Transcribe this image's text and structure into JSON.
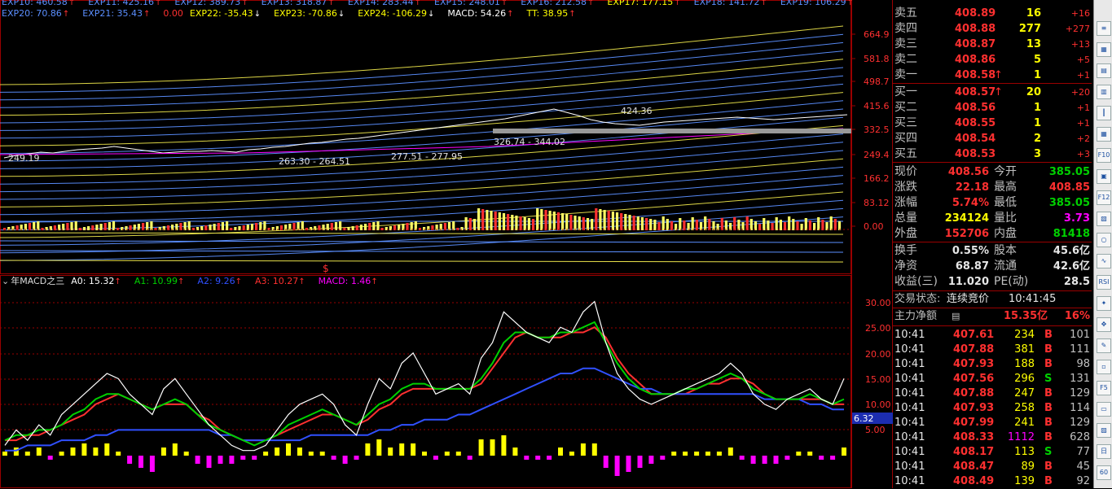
{
  "main_chart": {
    "legend_row1": [
      {
        "label": "EXP10: 460.58",
        "dir": "up"
      },
      {
        "label": "EXP11: 425.16",
        "dir": "up"
      },
      {
        "label": "EXP12: 389.73",
        "dir": "up"
      },
      {
        "label": "EXP13: 318.87",
        "dir": "up"
      },
      {
        "label": "EXP14: 283.44",
        "dir": "up"
      },
      {
        "label": "EXP15: 248.01",
        "dir": "up"
      },
      {
        "label": "EXP16: 212.58",
        "dir": "up"
      },
      {
        "label": "EXP17: 177.15",
        "dir": "up"
      },
      {
        "label": "EXP18: 141.72",
        "dir": "up"
      },
      {
        "label": "EXP19: 106.29",
        "dir": "up"
      }
    ],
    "legend_row2": [
      {
        "label": "EXP20: 70.86",
        "dir": "up"
      },
      {
        "label": "EXP21: 35.43",
        "dir": "up"
      },
      {
        "label": "0.00",
        "dir": "none"
      },
      {
        "label": "EXP22: -35.43",
        "dir": "down"
      },
      {
        "label": "EXP23: -70.86",
        "dir": "down"
      },
      {
        "label": "EXP24: -106.29",
        "dir": "down"
      },
      {
        "label": "MACD: 54.26",
        "dir": "up"
      },
      {
        "label": "TT: 38.95",
        "dir": "up"
      }
    ],
    "y_axis_labels": [
      "664.9",
      "581.8",
      "498.7",
      "415.6",
      "332.5",
      "249.4",
      "166.2",
      "83.12",
      "0.00"
    ],
    "annotations": [
      "249.19",
      "263.30 - 264.51",
      "277.51 - 277.95",
      "326.74 - 344.02",
      "424.36"
    ],
    "marker": "$"
  },
  "macd_panel": {
    "name": "年MACD之三",
    "legend": [
      {
        "label": "A0: 15.32",
        "color": "#ffffff"
      },
      {
        "label": "A1: 10.99",
        "color": "#00d000"
      },
      {
        "label": "A2: 9.26",
        "color": "#3050ff"
      },
      {
        "label": "A3: 10.27",
        "color": "#ff3030"
      },
      {
        "label": "MACD: 1.46",
        "color": "#ff00ff"
      }
    ],
    "y_axis_labels": [
      "30.00",
      "25.00",
      "20.00",
      "15.00",
      "10.00",
      "5.00"
    ],
    "current_value": "6.32"
  },
  "chart_data": {
    "type": "line",
    "title": "年MACD之三",
    "ylim": [
      0,
      32
    ],
    "series": [
      {
        "name": "A0",
        "values": [
          2,
          5,
          3,
          6,
          4,
          8,
          10,
          12,
          14,
          16,
          15,
          12,
          10,
          8,
          13,
          15,
          12,
          9,
          6,
          4,
          2,
          1,
          1,
          2,
          5,
          8,
          10,
          11,
          12,
          10,
          6,
          4,
          10,
          15,
          13,
          18,
          20,
          16,
          12,
          13,
          14,
          12,
          19,
          22,
          28,
          26,
          24,
          23,
          22,
          25,
          24,
          28,
          30,
          22,
          16,
          13,
          11,
          10,
          11,
          12,
          13,
          14,
          15,
          16,
          18,
          16,
          12,
          10,
          9,
          11,
          12,
          13,
          11,
          10,
          15
        ],
        "color": "#ffffff"
      },
      {
        "name": "A1",
        "values": [
          3,
          4,
          4,
          5,
          5,
          6,
          8,
          9,
          11,
          12,
          12,
          11,
          10,
          9,
          10,
          11,
          10,
          8,
          6,
          5,
          4,
          3,
          2,
          3,
          4,
          6,
          7,
          8,
          9,
          8,
          7,
          6,
          8,
          10,
          11,
          13,
          14,
          14,
          13,
          13,
          13,
          13,
          15,
          18,
          22,
          24,
          24,
          23,
          23,
          24,
          24,
          25,
          26,
          22,
          18,
          15,
          13,
          12,
          12,
          12,
          13,
          13,
          14,
          15,
          16,
          15,
          13,
          12,
          11,
          11,
          11,
          12,
          11,
          10,
          11
        ],
        "color": "#00d000"
      },
      {
        "name": "A2",
        "values": [
          1,
          1,
          2,
          2,
          2,
          3,
          3,
          3,
          4,
          4,
          5,
          5,
          5,
          5,
          5,
          5,
          5,
          5,
          5,
          4,
          4,
          3,
          3,
          3,
          3,
          3,
          3,
          4,
          4,
          4,
          4,
          4,
          4,
          5,
          5,
          6,
          6,
          7,
          7,
          7,
          8,
          8,
          9,
          10,
          11,
          12,
          13,
          14,
          15,
          16,
          16,
          17,
          17,
          16,
          15,
          14,
          13,
          13,
          12,
          12,
          12,
          12,
          12,
          12,
          12,
          12,
          12,
          11,
          11,
          11,
          11,
          10,
          10,
          9,
          9
        ],
        "color": "#3050ff"
      },
      {
        "name": "A3",
        "values": [
          3,
          3,
          4,
          4,
          5,
          6,
          7,
          8,
          10,
          11,
          12,
          11,
          10,
          9,
          10,
          10,
          10,
          8,
          7,
          5,
          4,
          3,
          3,
          3,
          4,
          5,
          6,
          7,
          8,
          8,
          7,
          6,
          7,
          9,
          10,
          12,
          13,
          13,
          13,
          13,
          13,
          13,
          14,
          17,
          20,
          23,
          24,
          23,
          23,
          23,
          24,
          24,
          25,
          23,
          19,
          16,
          14,
          12,
          12,
          12,
          12,
          13,
          14,
          14,
          15,
          15,
          14,
          12,
          11,
          11,
          11,
          11,
          11,
          10,
          10
        ],
        "color": "#ff3030"
      }
    ],
    "macd_bars": [
      1,
      2,
      1,
      2,
      -1,
      1,
      2,
      3,
      2,
      3,
      1,
      -2,
      -3,
      -4,
      2,
      3,
      1,
      -2,
      -3,
      -2,
      -2,
      -1,
      -1,
      1,
      2,
      3,
      2,
      1,
      1,
      -1,
      -2,
      -1,
      3,
      4,
      2,
      3,
      3,
      1,
      -1,
      1,
      1,
      -1,
      4,
      4,
      5,
      2,
      -1,
      -1,
      -1,
      2,
      1,
      3,
      3,
      -3,
      -5,
      -4,
      -3,
      -2,
      -1,
      1,
      1,
      1,
      1,
      1,
      2,
      -1,
      -2,
      -2,
      -2,
      -1,
      1,
      1,
      -1,
      -1,
      2
    ]
  },
  "quote": {
    "asks": [
      {
        "label": "卖五",
        "price": "408.89",
        "vol": "16",
        "chg": "+16"
      },
      {
        "label": "卖四",
        "price": "408.88",
        "vol": "277",
        "chg": "+277"
      },
      {
        "label": "卖三",
        "price": "408.87",
        "vol": "13",
        "chg": "+13"
      },
      {
        "label": "卖二",
        "price": "408.86",
        "vol": "5",
        "chg": "+5"
      },
      {
        "label": "卖一",
        "price": "408.58",
        "arrow": "↑",
        "vol": "1",
        "chg": "+1"
      }
    ],
    "bids": [
      {
        "label": "买一",
        "price": "408.57",
        "arrow": "↑",
        "vol": "20",
        "chg": "+20"
      },
      {
        "label": "买二",
        "price": "408.56",
        "vol": "1",
        "chg": "+1"
      },
      {
        "label": "买三",
        "price": "408.55",
        "vol": "1",
        "chg": "+1"
      },
      {
        "label": "买四",
        "price": "408.54",
        "vol": "2",
        "chg": "+2"
      },
      {
        "label": "买五",
        "price": "408.53",
        "vol": "3",
        "chg": "+3"
      }
    ],
    "stats": [
      {
        "l1": "现价",
        "v1": "408.56",
        "c1": "red",
        "l2": "今开",
        "v2": "385.05",
        "c2": "green"
      },
      {
        "l1": "涨跌",
        "v1": "22.18",
        "c1": "red",
        "l2": "最高",
        "v2": "408.85",
        "c2": "red"
      },
      {
        "l1": "涨幅",
        "v1": "5.74%",
        "c1": "red",
        "l2": "最低",
        "v2": "385.05",
        "c2": "green"
      },
      {
        "l1": "总量",
        "v1": "234124",
        "c1": "yellow",
        "l2": "量比",
        "v2": "3.73",
        "c2": "magenta"
      },
      {
        "l1": "外盘",
        "v1": "152706",
        "c1": "red",
        "l2": "内盘",
        "v2": "81418",
        "c2": "green"
      },
      {
        "l1": "换手",
        "v1": "0.55%",
        "c1": "white",
        "l2": "股本",
        "v2": "45.6亿",
        "c2": "white"
      },
      {
        "l1": "净资",
        "v1": "68.87",
        "c1": "white",
        "l2": "流通",
        "v2": "42.6亿",
        "c2": "white"
      },
      {
        "l1": "收益(三)",
        "v1": "11.020",
        "c1": "white",
        "l2": "PE(动)",
        "v2": "28.5",
        "c2": "white"
      }
    ],
    "trade_status_label": "交易状态:",
    "trade_status": "连续竞价",
    "trade_time": "10:41:45",
    "main_net_label": "主力净额",
    "main_net_value": "15.35亿",
    "main_net_pct": "16%",
    "ticks": [
      {
        "t": "10:41",
        "p": "407.61",
        "v": "234",
        "s": "B",
        "n": "101"
      },
      {
        "t": "10:41",
        "p": "407.88",
        "v": "381",
        "s": "B",
        "n": "111"
      },
      {
        "t": "10:41",
        "p": "407.93",
        "v": "188",
        "s": "B",
        "n": "98"
      },
      {
        "t": "10:41",
        "p": "407.56",
        "v": "296",
        "s": "S",
        "n": "131"
      },
      {
        "t": "10:41",
        "p": "407.88",
        "v": "247",
        "s": "B",
        "n": "129"
      },
      {
        "t": "10:41",
        "p": "407.93",
        "v": "258",
        "s": "B",
        "n": "114"
      },
      {
        "t": "10:41",
        "p": "407.99",
        "v": "241",
        "s": "B",
        "n": "129"
      },
      {
        "t": "10:41",
        "p": "408.33",
        "v": "1112",
        "s": "B",
        "n": "628"
      },
      {
        "t": "10:41",
        "p": "408.17",
        "v": "113",
        "s": "S",
        "n": "77"
      },
      {
        "t": "10:41",
        "p": "408.47",
        "v": "89",
        "s": "B",
        "n": "45"
      },
      {
        "t": "10:41",
        "p": "408.49",
        "v": "139",
        "s": "B",
        "n": "92"
      }
    ]
  },
  "toolbar": [
    {
      "icon": "list-icon",
      "glyph": "≡"
    },
    {
      "icon": "grid-icon",
      "glyph": "▦"
    },
    {
      "icon": "book-icon",
      "glyph": "▤"
    },
    {
      "icon": "doc-icon",
      "glyph": "▥"
    },
    {
      "icon": "candle-icon",
      "glyph": "┃"
    },
    {
      "icon": "table-icon",
      "glyph": "▦"
    },
    {
      "icon": "f10-icon",
      "glyph": "F10"
    },
    {
      "icon": "note-icon",
      "glyph": "▣"
    },
    {
      "icon": "f12-icon",
      "glyph": "F12"
    },
    {
      "icon": "chart-icon",
      "glyph": "▧"
    },
    {
      "icon": "ring-icon",
      "glyph": "○"
    },
    {
      "icon": "wave-icon",
      "glyph": "∿"
    },
    {
      "icon": "rsi-icon",
      "glyph": "RSI"
    },
    {
      "icon": "compass-icon",
      "glyph": "✦"
    },
    {
      "icon": "move-icon",
      "glyph": "✥"
    },
    {
      "icon": "pen-icon",
      "glyph": "✎"
    },
    {
      "icon": "box-icon",
      "glyph": "▫"
    },
    {
      "icon": "f5-icon",
      "glyph": "F5"
    },
    {
      "icon": "window-icon",
      "glyph": "▭"
    },
    {
      "icon": "image-icon",
      "glyph": "▨"
    },
    {
      "icon": "calendar-icon",
      "glyph": "日"
    },
    {
      "icon": "sixty-icon",
      "glyph": "60"
    }
  ]
}
